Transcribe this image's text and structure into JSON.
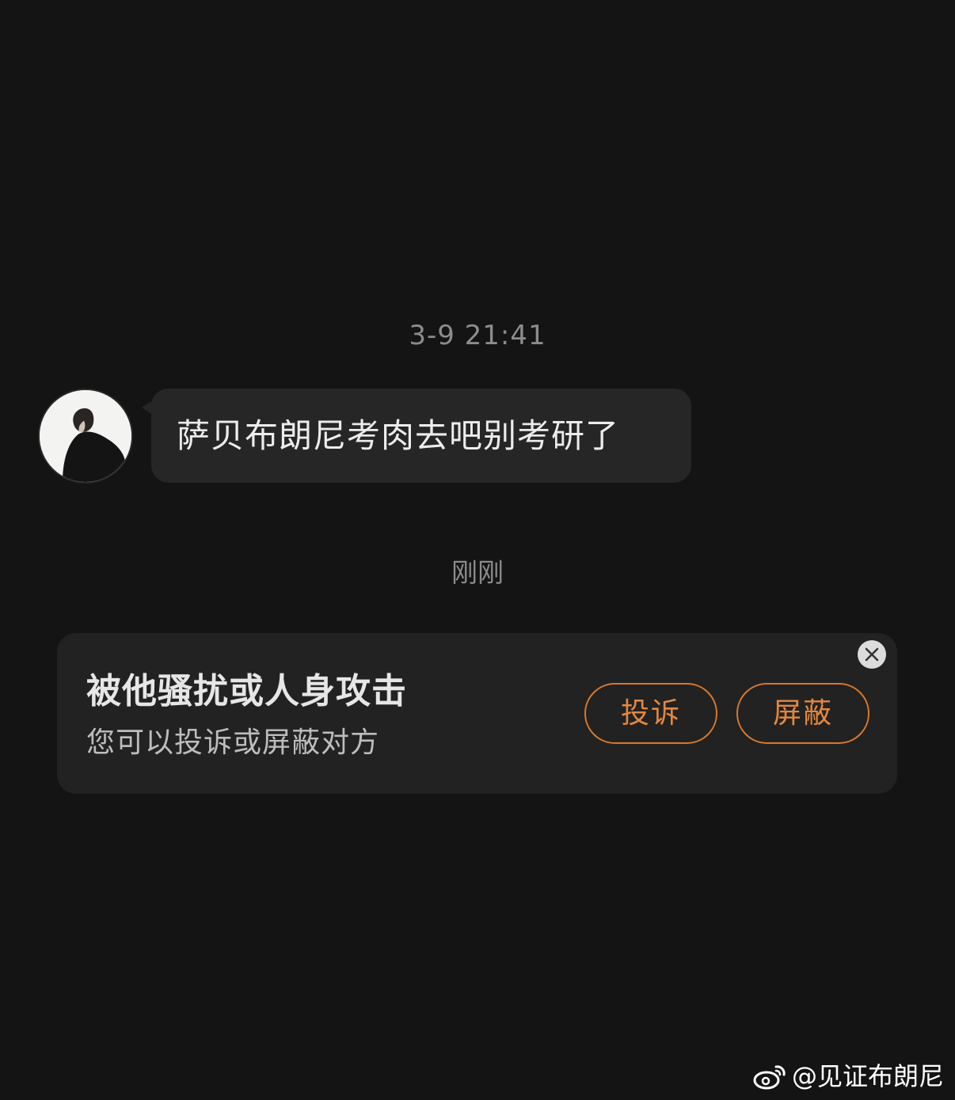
{
  "messages": {
    "timestamp_1": "3-9 21:41",
    "incoming_text": "萨贝布朗尼考肉去吧别考研了",
    "timestamp_2": "刚刚"
  },
  "report_card": {
    "title": "被他骚扰或人身攻击",
    "subtitle": "您可以投诉或屏蔽对方",
    "report_label": "投诉",
    "block_label": "屏蔽",
    "accent_color": "#e4873d"
  },
  "watermark": {
    "handle": "@见证布朗尼",
    "logo_icon": "weibo-logo-icon"
  },
  "colors": {
    "background": "#141414",
    "bubble": "#262626",
    "card": "#222222"
  }
}
